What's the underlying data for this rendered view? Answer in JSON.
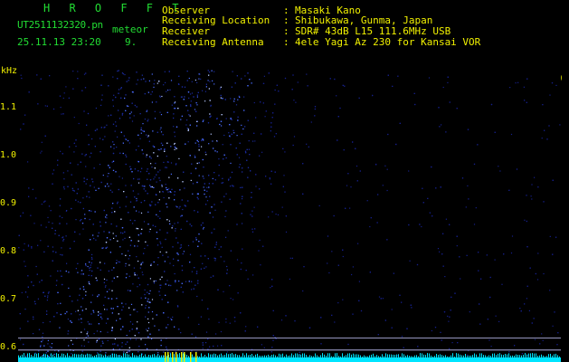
{
  "header": {
    "app_title": "H R O F F T",
    "file_name": "UT2511132320.pn",
    "mode": "meteor",
    "datetime": "25.11.13 23:20",
    "misc_value": "9."
  },
  "info": [
    {
      "label": "Observer",
      "value": "Masaki Kano"
    },
    {
      "label": "Receiving Location",
      "value": "Shibukawa, Gunma, Japan"
    },
    {
      "label": "Receiver",
      "value": "SDR# 43dB L15 111.6MHz USB"
    },
    {
      "label": "Receiving Antenna",
      "value": "4ele Yagi Az 230 for Kansai VOR"
    }
  ],
  "info_separator": ":",
  "colors": {
    "background": "#000000",
    "title_green": "#22dd33",
    "label_yellow": "#f0f000",
    "signal_blue": "#3355ff",
    "baseline_cyan": "#00e5ff"
  },
  "chart_data": {
    "type": "heatmap",
    "ylabel": "kHz",
    "y_ticks": [
      "1.1",
      "1.0",
      "0.9",
      "0.8",
      "0.7",
      "0.6"
    ],
    "y_tick_values": [
      1.1,
      1.0,
      0.9,
      0.8,
      0.7,
      0.6
    ],
    "ylim": [
      0.57,
      1.18
    ],
    "x_ticks": [
      "232",
      "232",
      "232",
      "232",
      "232",
      "232",
      "232",
      "232",
      "232",
      "2330"
    ],
    "xlim": [
      0,
      10
    ],
    "x_tick_values": [
      1,
      2,
      3,
      4,
      5,
      6,
      7,
      8,
      9,
      10
    ],
    "horizontal_lines_khz": [
      0.62,
      0.595
    ],
    "description_free": true
  }
}
